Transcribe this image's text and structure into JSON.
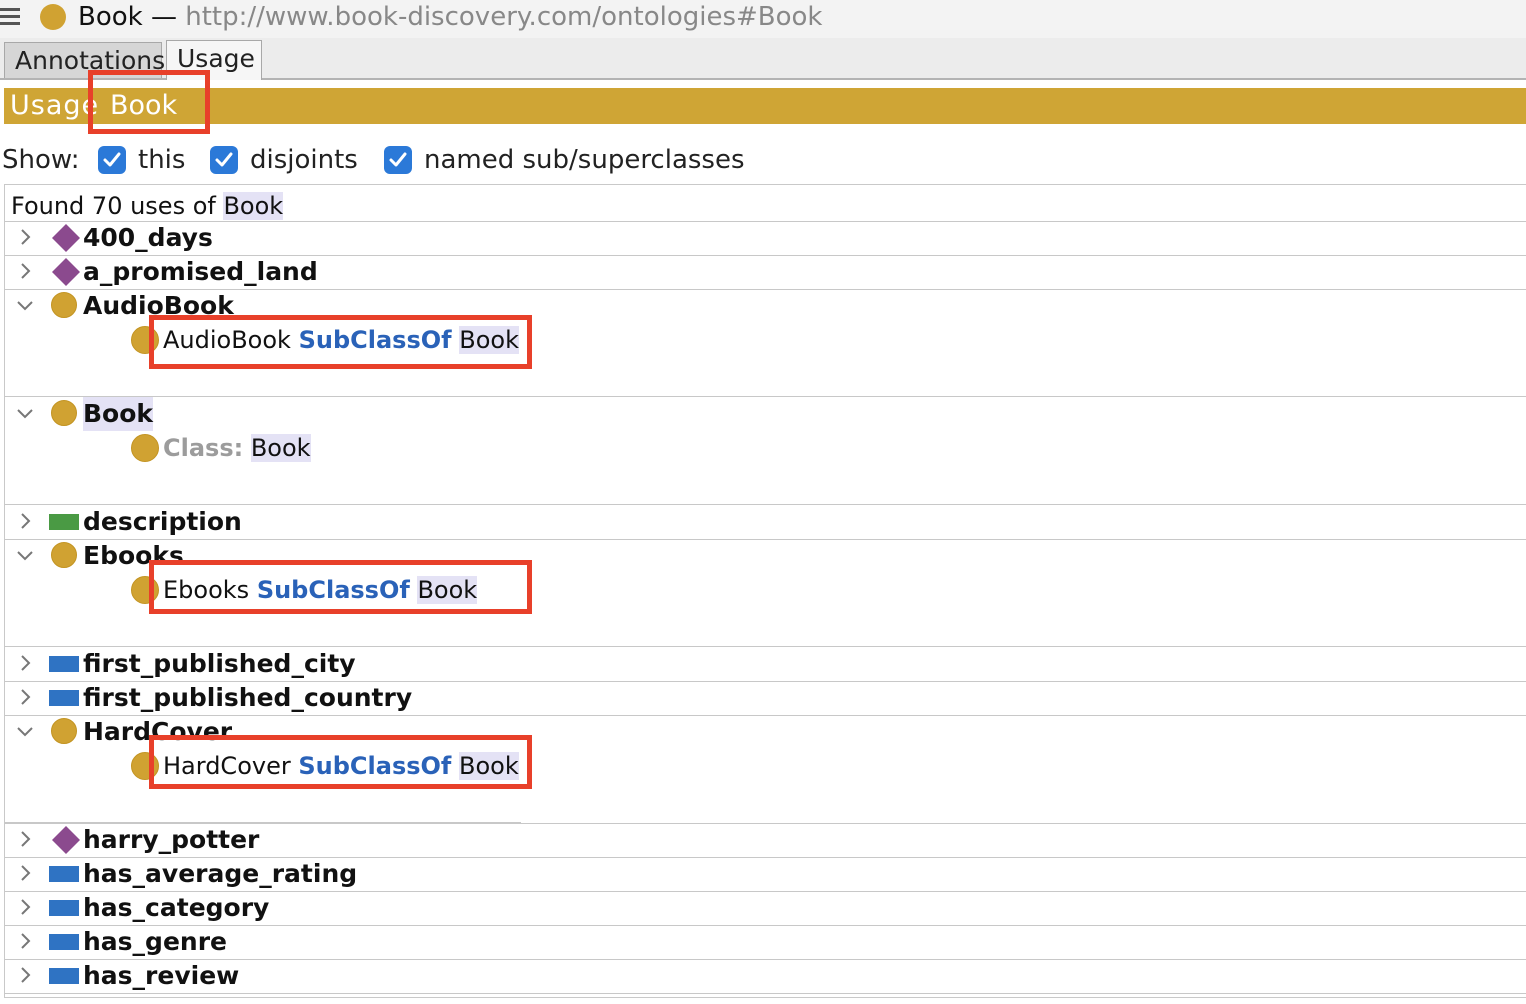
{
  "window": {
    "title_name": "Book",
    "title_separator": " — ",
    "title_iri": "http://www.book-discovery.com/ontologies#Book",
    "accent_color": "#d0a232"
  },
  "tabs": [
    {
      "label": "Annotations",
      "selected": false
    },
    {
      "label": "Usage",
      "selected": true
    }
  ],
  "usage_header": {
    "label": "Usage",
    "entity": "Book",
    "background_color": "#cfa535"
  },
  "show": {
    "label": "Show:",
    "options": [
      {
        "label": "this",
        "checked": true
      },
      {
        "label": "disjoints",
        "checked": true
      },
      {
        "label": "named sub/superclasses",
        "checked": true
      }
    ]
  },
  "results": {
    "found_prefix": "Found 70 uses of ",
    "found_entity": "Book",
    "items": [
      {
        "label": "400_days",
        "kind": "individual-icon",
        "expanded": false
      },
      {
        "label": "a_promised_land",
        "kind": "individual-icon",
        "expanded": false
      },
      {
        "label": "AudioBook",
        "kind": "class-icon",
        "expanded": true,
        "children": [
          {
            "subject": "AudioBook",
            "keyword": "SubClassOf",
            "object": "Book"
          }
        ]
      },
      {
        "label": "Book",
        "kind": "class-icon",
        "expanded": true,
        "children": [
          {
            "keyword": "Class:",
            "object": "Book"
          }
        ]
      },
      {
        "label": "description",
        "kind": "data-property-icon",
        "expanded": false
      },
      {
        "label": "Ebooks",
        "kind": "class-icon",
        "expanded": true,
        "children": [
          {
            "subject": "Ebooks",
            "keyword": "SubClassOf",
            "object": "Book"
          }
        ]
      },
      {
        "label": "first_published_city",
        "kind": "object-property-icon",
        "expanded": false
      },
      {
        "label": "first_published_country",
        "kind": "object-property-icon",
        "expanded": false
      },
      {
        "label": "HardCover",
        "kind": "class-icon",
        "expanded": true,
        "children": [
          {
            "subject": "HardCover",
            "keyword": "SubClassOf",
            "object": "Book"
          }
        ]
      },
      {
        "label": "harry_potter",
        "kind": "individual-icon",
        "expanded": false
      },
      {
        "label": "has_average_rating",
        "kind": "object-property-icon",
        "expanded": false
      },
      {
        "label": "has_category",
        "kind": "object-property-icon",
        "expanded": false
      },
      {
        "label": "has_genre",
        "kind": "object-property-icon",
        "expanded": false
      },
      {
        "label": "has_review",
        "kind": "object-property-icon",
        "expanded": false
      }
    ]
  }
}
